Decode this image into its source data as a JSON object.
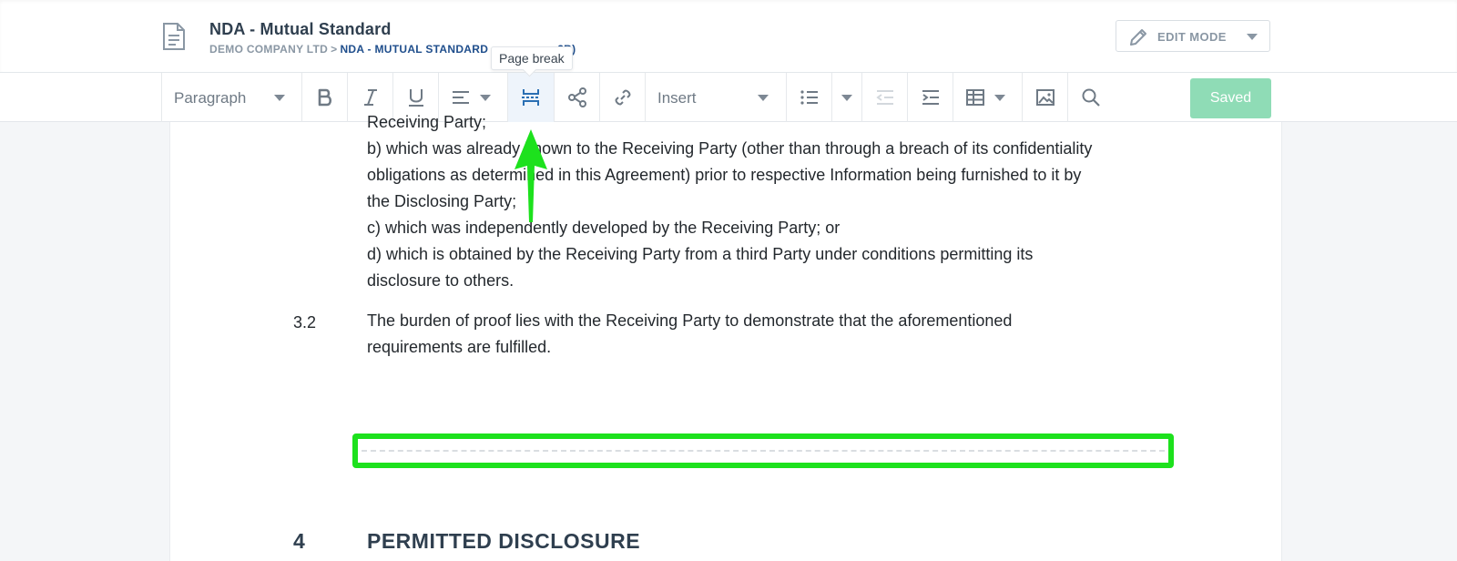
{
  "header": {
    "title": "NDA - Mutual Standard",
    "breadcrumb_company": "DEMO COMPANY LTD",
    "breadcrumb_separator": ">",
    "breadcrumb_doc": "NDA - MUTUAL STANDARD",
    "breadcrumb_doc_tail": "2B)",
    "edit_mode_label": "EDIT MODE"
  },
  "toolbar": {
    "paragraph_label": "Paragraph",
    "insert_label": "Insert",
    "saved_label": "Saved",
    "tooltip": "Page break",
    "icons": [
      "bold-icon",
      "italic-icon",
      "underline-icon",
      "align-icon",
      "page-break-icon",
      "share-icon",
      "link-icon",
      "bullet-list-icon",
      "outdent-icon",
      "indent-icon",
      "table-icon",
      "image-icon",
      "search-icon"
    ]
  },
  "document": {
    "lines": [
      "Receiving Party;",
      "b) which was already known to the Receiving Party (other than through a breach of its confidentiality",
      "obligations as determined in this Agreement) prior to respective Information being furnished to it by",
      "the Disclosing Party;",
      "c) which was independently developed by the Receiving Party; or",
      "d) which is obtained by the Receiving Party from a third Party under conditions permitting its",
      "disclosure to others."
    ],
    "clause_32_number": "3.2",
    "clause_32_lines": [
      "The burden of proof lies with the Receiving Party to demonstrate that the aforementioned",
      "requirements are fulfilled."
    ],
    "section_4_number": "4",
    "section_4_title": "PERMITTED DISCLOSURE"
  },
  "colors": {
    "accent_blue": "#1f4e8c",
    "saved_green": "#8fdcb6",
    "highlight_green": "#1de11d"
  }
}
